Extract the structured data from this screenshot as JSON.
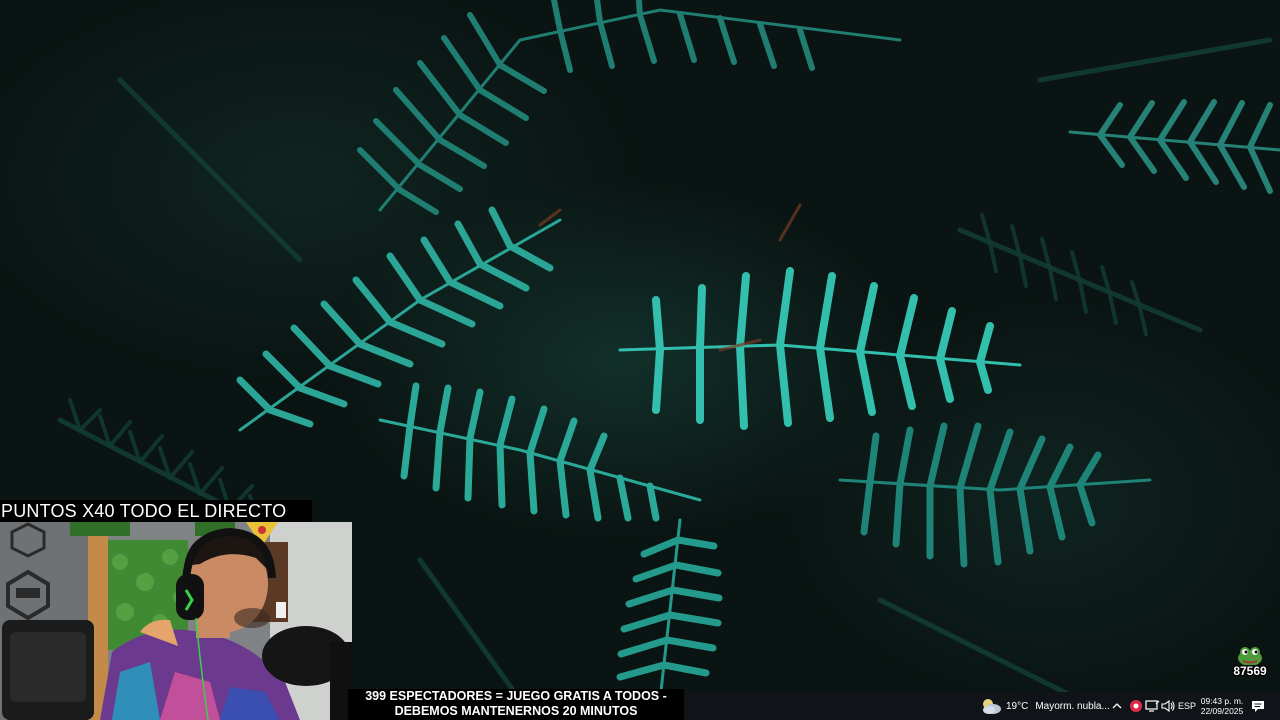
{
  "overlay": {
    "points_banner": "PUNTOS X40 TODO EL DIRECTO",
    "viewers_goal_line1": "399 ESPECTADORES = JUEGO GRATIS A TODOS -",
    "viewers_goal_line2": "DEBEMOS MANTENERNOS 20 MINUTOS",
    "channel_points": "87569"
  },
  "taskbar": {
    "weather_icon": "cloudy-moon-icon",
    "temperature": "19°C",
    "weather_description": "Mayorm. nubla...",
    "tray_chevron": "^",
    "language": "ESP",
    "time": "09:43 p. m.",
    "date": "22/09/2025"
  },
  "colors": {
    "fern": "#2fb3a2",
    "fern_dark": "#16524a",
    "taskbar_bg": "#101418",
    "banner_bg": "#000000"
  }
}
